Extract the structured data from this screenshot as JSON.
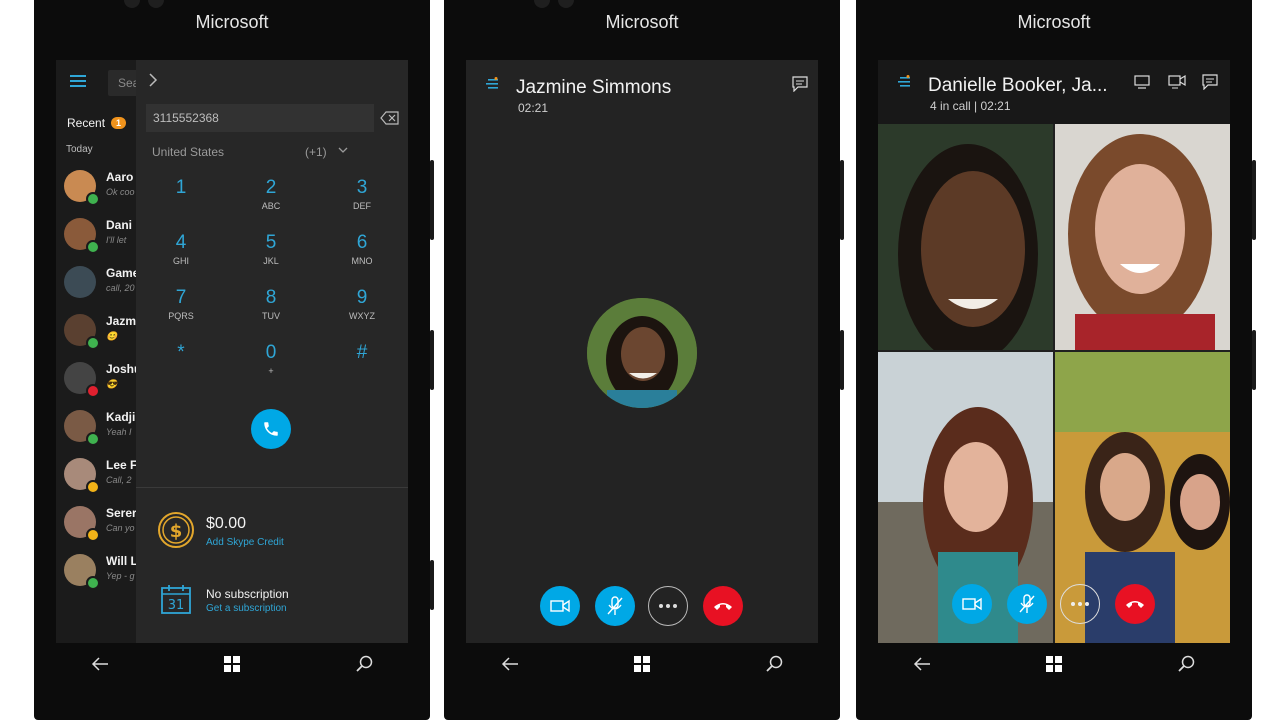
{
  "brand": "Microsoft",
  "phone1": {
    "search_placeholder": "Sea",
    "recent_label": "Recent",
    "recent_count": "1",
    "today_label": "Today",
    "contacts": [
      {
        "name": "Aaro",
        "sub": "Ok coo",
        "status": "#3fb24f",
        "avatar": "#c98a52"
      },
      {
        "name": "Dani",
        "sub": "I'll let",
        "status": "#3fb24f",
        "avatar": "#8a5a3a"
      },
      {
        "name": "Game",
        "sub": "call, 20",
        "status": "",
        "avatar": "#3c4b55"
      },
      {
        "name": "Jazm",
        "sub": "😊",
        "status": "#3fb24f",
        "avatar": "#5a4030"
      },
      {
        "name": "Joshu",
        "sub": "😎",
        "status": "#e0202f",
        "avatar": "#444"
      },
      {
        "name": "Kadji",
        "sub": "Yeah I",
        "status": "#3fb24f",
        "avatar": "#7a5a45"
      },
      {
        "name": "Lee F",
        "sub": "Call, 2",
        "status": "#f2b318",
        "avatar": "#a88a7a"
      },
      {
        "name": "Serer",
        "sub": "Can yo",
        "status": "#f2b318",
        "avatar": "#9a7565"
      },
      {
        "name": "Will L",
        "sub": "Yep - g",
        "status": "#3fb24f",
        "avatar": "#9a8060"
      }
    ],
    "dial_number": "3115552368",
    "country": "United States",
    "country_code": "(+1)",
    "keys": [
      {
        "d": "1",
        "l": ""
      },
      {
        "d": "2",
        "l": "ABC"
      },
      {
        "d": "3",
        "l": "DEF"
      },
      {
        "d": "4",
        "l": "GHI"
      },
      {
        "d": "5",
        "l": "JKL"
      },
      {
        "d": "6",
        "l": "MNO"
      },
      {
        "d": "7",
        "l": "PQRS"
      },
      {
        "d": "8",
        "l": "TUV"
      },
      {
        "d": "9",
        "l": "WXYZ"
      },
      {
        "d": "*",
        "l": ""
      },
      {
        "d": "0",
        "l": "+"
      },
      {
        "d": "#",
        "l": ""
      }
    ],
    "credit_amount": "$0.00",
    "credit_link": "Add Skype Credit",
    "subscription_text": "No subscription",
    "subscription_link": "Get a subscription",
    "calendar_day": "31"
  },
  "phone2": {
    "caller_name": "Jazmine Simmons",
    "call_time": "02:21"
  },
  "phone3": {
    "group_name": "Danielle Booker, Ja...",
    "call_status": "4 in call | 02:21"
  },
  "colors": {
    "accent": "#00a8e6",
    "end_call": "#e81123",
    "dial_digit": "#2fa6d6"
  }
}
